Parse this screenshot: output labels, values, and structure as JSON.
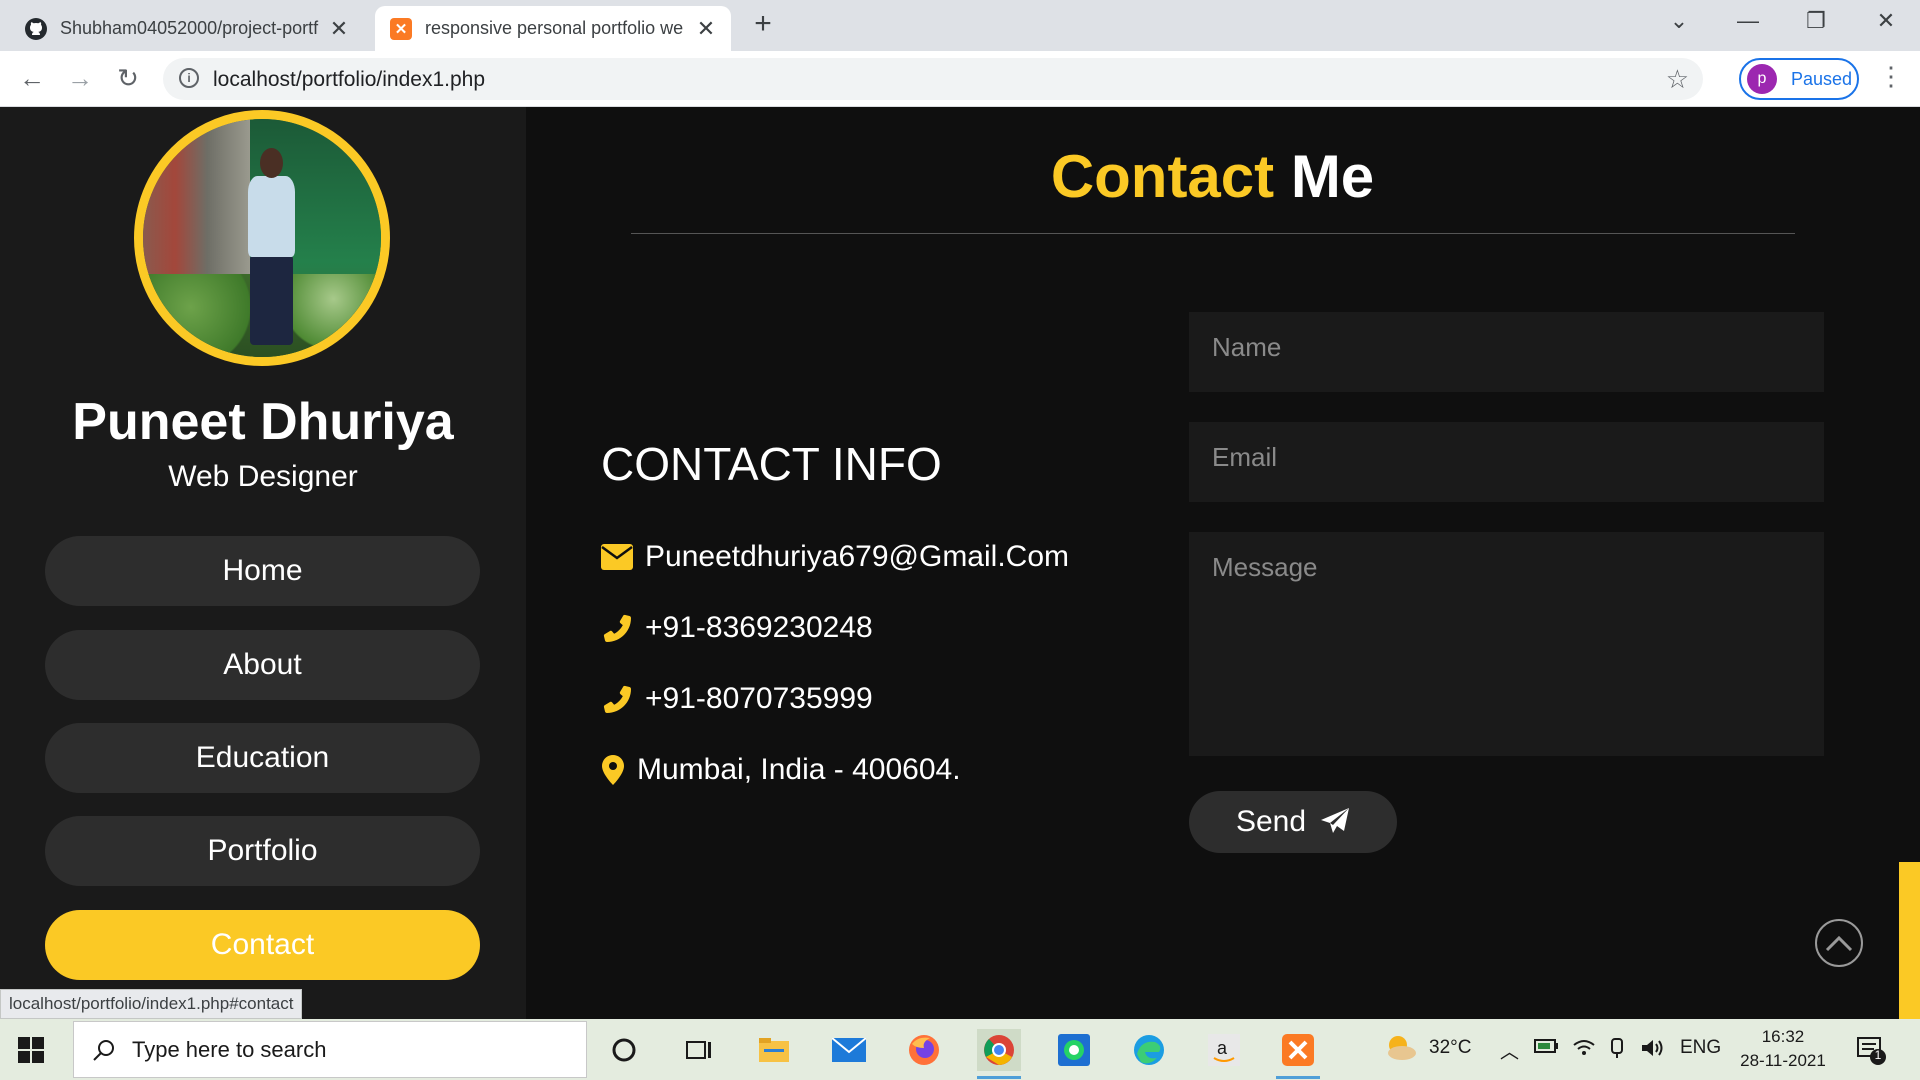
{
  "browser": {
    "tabs": [
      {
        "title": "Shubham04052000/project-portf",
        "icon": "github-icon",
        "active": false
      },
      {
        "title": "responsive personal portfolio we",
        "icon": "xampp-icon",
        "active": true
      }
    ],
    "url": "localhost/portfolio/index1.php",
    "profile_initial": "p",
    "profile_status": "Paused",
    "status_url": "localhost/portfolio/index1.php#contact"
  },
  "sidebar": {
    "name": "Puneet Dhuriya",
    "role": "Web Designer",
    "nav": [
      {
        "label": "Home",
        "active": false
      },
      {
        "label": "About",
        "active": false
      },
      {
        "label": "Education",
        "active": false
      },
      {
        "label": "Portfolio",
        "active": false
      },
      {
        "label": "Contact",
        "active": true
      }
    ]
  },
  "contact": {
    "heading_highlight": "Contact",
    "heading_rest": "Me",
    "info_title": "CONTACT INFO",
    "email": "Puneetdhuriya679@Gmail.Com",
    "phone1": "+91-8369230248",
    "phone2": "+91-8070735999",
    "address": "Mumbai, India - 400604.",
    "form": {
      "name_placeholder": "Name",
      "email_placeholder": "Email",
      "message_placeholder": "Message",
      "send_label": "Send"
    }
  },
  "taskbar": {
    "search_placeholder": "Type here to search",
    "temperature": "32°C",
    "language": "ENG",
    "time": "16:32",
    "date": "28-11-2021",
    "notification_count": "1"
  },
  "colors": {
    "accent": "#fbc925",
    "sidebar_bg": "#1a1a1a",
    "page_bg": "#0f0f0f",
    "button_bg": "#2d2d2d"
  }
}
